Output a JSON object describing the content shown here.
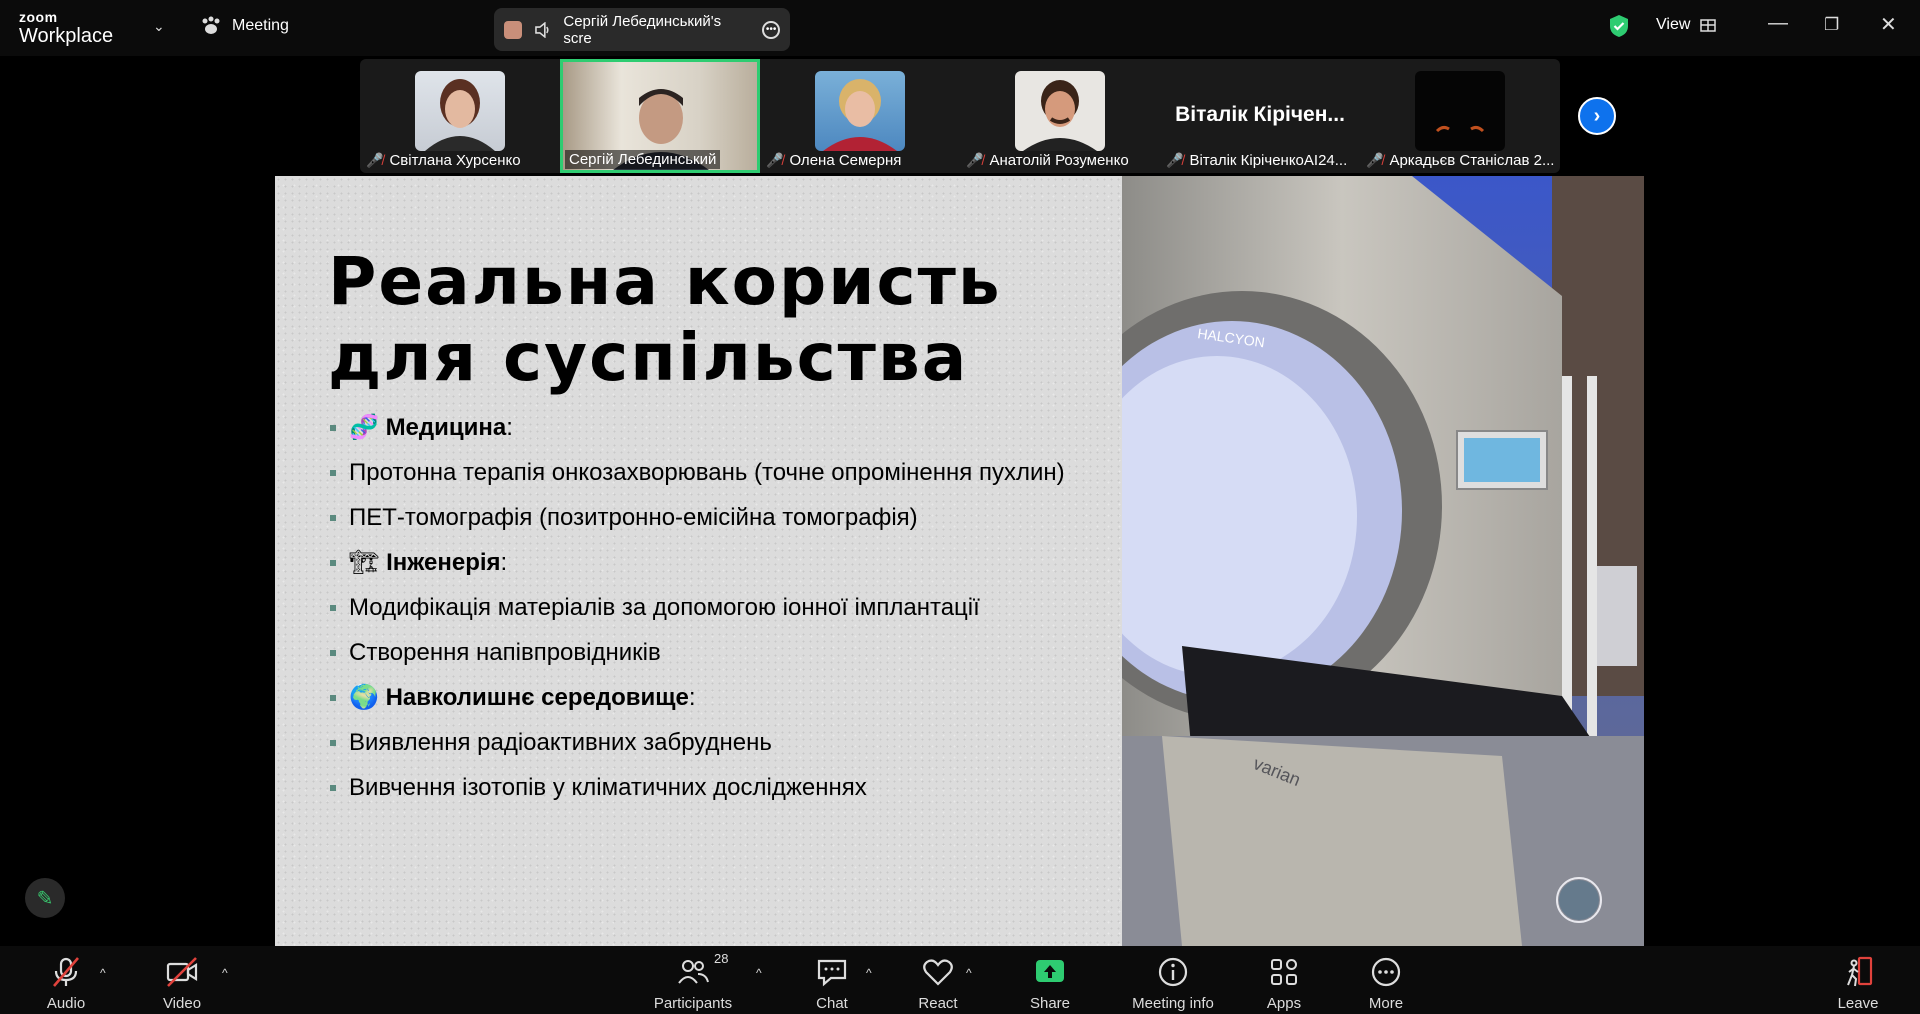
{
  "titlebar": {
    "logo_top": "zoom",
    "logo_bottom": "Workplace",
    "meeting_label": "Meeting",
    "share_text": "Сергій Лебединський's scre",
    "view_label": "View"
  },
  "gallery": {
    "tiles": [
      {
        "name": "Світлана Хурсенко",
        "muted": true
      },
      {
        "name": "Сергій Лебединський",
        "muted": false,
        "active": true
      },
      {
        "name": "Олена Семерня",
        "muted": true
      },
      {
        "name": "Анатолій Розуменко",
        "muted": true
      },
      {
        "name": "Віталік КірічeнкоAI24...",
        "big_name": "Віталік Кірічен...",
        "muted": true
      },
      {
        "name": "Аркадьєв Станіслав 2...",
        "muted": true
      }
    ]
  },
  "slide": {
    "title_line1": "Реальна користь",
    "title_line2": "для суспільства",
    "items": [
      {
        "emoji": "🧬",
        "bold": "Медицина",
        "rest": ":"
      },
      {
        "emoji": "",
        "bold": "",
        "rest": "Протонна терапія онкозахворювань (точне опромінення пухлин)"
      },
      {
        "emoji": "",
        "bold": "",
        "rest": "ПЕТ-томографія (позитронно-емісійна томографія)"
      },
      {
        "emoji": "🏗",
        "bold": "Інженерія",
        "rest": ":"
      },
      {
        "emoji": "",
        "bold": "",
        "rest": "Модифікація матеріалів за допомогою іонної імплантації"
      },
      {
        "emoji": "",
        "bold": "",
        "rest": "Створення напівпровідників"
      },
      {
        "emoji": "🌍",
        "bold": "Навколишнє середовище",
        "rest": ":"
      },
      {
        "emoji": "",
        "bold": "",
        "rest": "Виявлення радіоактивних забруднень"
      },
      {
        "emoji": "",
        "bold": "",
        "rest": "Вивчення ізотопів у кліматичних дослідженнях"
      }
    ],
    "machine_brand": "HALCYON",
    "machine_maker": "varian"
  },
  "toolbar": {
    "audio": "Audio",
    "video": "Video",
    "participants": "Participants",
    "participants_count": "28",
    "chat": "Chat",
    "react": "React",
    "share": "Share",
    "meeting_info": "Meeting info",
    "apps": "Apps",
    "more": "More",
    "leave": "Leave"
  }
}
